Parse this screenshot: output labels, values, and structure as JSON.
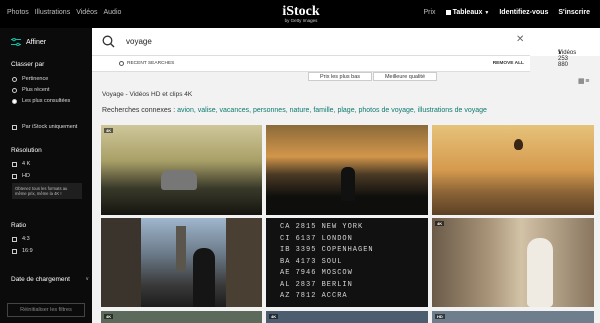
{
  "topbar": {
    "nav": [
      "Photos",
      "Illustrations",
      "Vidéos",
      "Audio"
    ],
    "logo_main": "iStock",
    "logo_sub": "by Getty Images",
    "pricing": "Prix",
    "boards": "Tableaux",
    "signin": "Identifiez-vous",
    "signup": "S'inscrire"
  },
  "sidebar": {
    "filter_label": "Affiner",
    "sort_heading": "Classer par",
    "sort_options": [
      "Pertinence",
      "Plus récent",
      "Les plus consultées"
    ],
    "istock_only": "Par iStock uniquement",
    "resolution_heading": "Résolution",
    "res_options": [
      "4 K",
      "HD"
    ],
    "res_note": "Obtenez tous les formats au même prix, même la 4K !",
    "ratio_heading": "Ratio",
    "ratio_options": [
      "4:3",
      "16:9"
    ],
    "date_heading": "Date de chargement",
    "reset": "Réinitialiser les filtres"
  },
  "search": {
    "query": "voyage",
    "result_count": "1 253 880",
    "result_type": "Vidéos",
    "recent_label": "RECENT SEARCHES",
    "remove_all": "REMOVE ALL"
  },
  "sort_buttons": [
    "Prix les plus bas",
    "Meilleure qualité"
  ],
  "results_title": "Voyage - Vidéos HD et clips 4K",
  "related": {
    "label": "Recherches connexes :",
    "keywords": [
      "avion",
      "valise",
      "vacances",
      "personnes",
      "nature",
      "famille",
      "plage",
      "photos de voyage",
      "illustrations de voyage"
    ]
  },
  "badges": {
    "k4": "4K",
    "hd": "HD"
  },
  "board_rows": [
    "CA 2815 NEW YORK",
    "CI 6137 LONDON",
    "IB 3395 COPENHAGEN",
    "BA 4173 SOUL",
    "AE 7946 MOSCOW",
    "AL 2837 BERLIN",
    "AZ 7812 ACCRA"
  ]
}
